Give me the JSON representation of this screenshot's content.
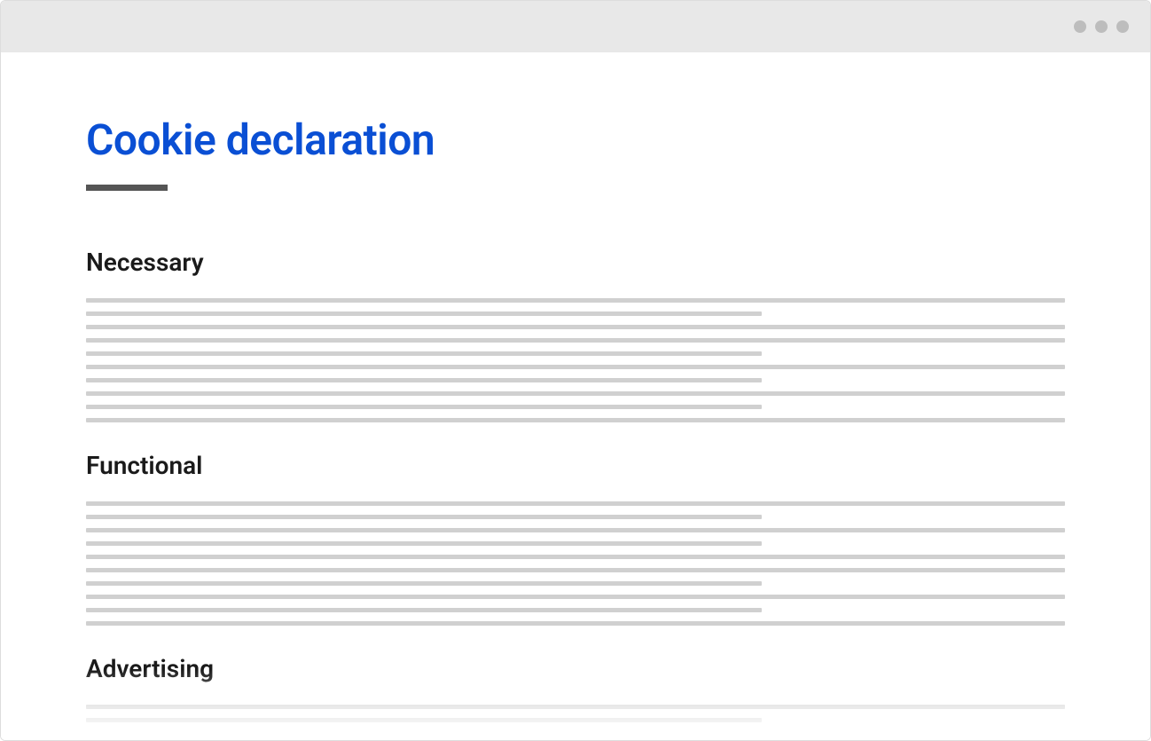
{
  "page": {
    "title": "Cookie declaration"
  },
  "sections": [
    {
      "heading": "Necessary"
    },
    {
      "heading": "Functional"
    },
    {
      "heading": "Advertising"
    }
  ]
}
